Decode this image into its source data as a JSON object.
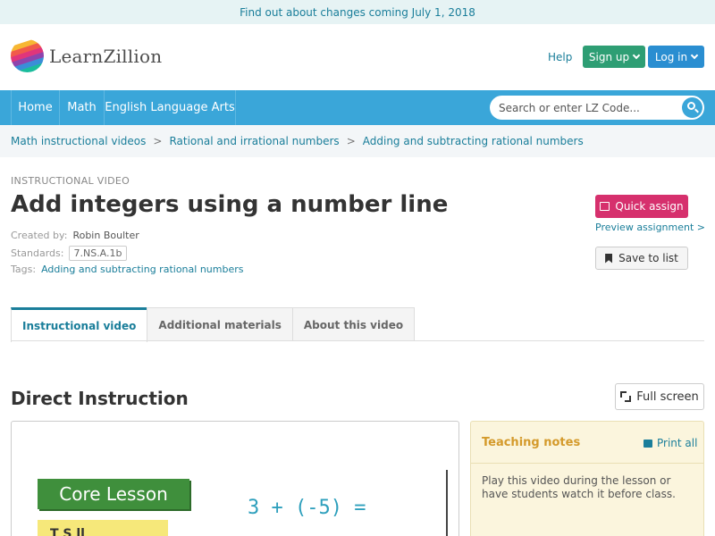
{
  "banner": {
    "text": "Find out about changes coming July 1, 2018"
  },
  "header": {
    "logo_text": "LearnZillion",
    "help": "Help",
    "signup": "Sign up",
    "login": "Log in"
  },
  "nav": {
    "items": [
      {
        "label": "Home"
      },
      {
        "label": "Math"
      },
      {
        "label": "English Language Arts"
      }
    ],
    "search_placeholder": "Search or enter LZ Code..."
  },
  "breadcrumb": [
    {
      "label": "Math instructional videos"
    },
    {
      "label": "Rational and irrational numbers"
    },
    {
      "label": "Adding and subtracting rational numbers"
    }
  ],
  "lesson": {
    "kicker": "INSTRUCTIONAL VIDEO",
    "title": "Add integers using a number line",
    "created_label": "Created by:",
    "created_by": "Robin Boulter",
    "standards_label": "Standards:",
    "standard": "7.NS.A.1b",
    "tags_label": "Tags:",
    "tag": "Adding and subtracting rational numbers"
  },
  "actions": {
    "quick_assign": "Quick assign",
    "preview": "Preview assignment >",
    "save": "Save to list"
  },
  "tabs": [
    {
      "label": "Instructional video"
    },
    {
      "label": "Additional materials"
    },
    {
      "label": "About this video"
    }
  ],
  "section": {
    "title": "Direct Instruction",
    "fullscreen": "Full screen"
  },
  "video": {
    "core_label": "Core Lesson",
    "note_text": "T S   ll",
    "expression": "3 + (-5) ="
  },
  "notes": {
    "title": "Teaching notes",
    "print": "Print all",
    "body": "Play this video during the lesson or have students watch it before class."
  },
  "colors": {
    "accent": "#1a7e9a",
    "nav": "#3aa6d9",
    "signup": "#2e9e74",
    "login": "#2a8ed1",
    "assign": "#d6306d"
  }
}
